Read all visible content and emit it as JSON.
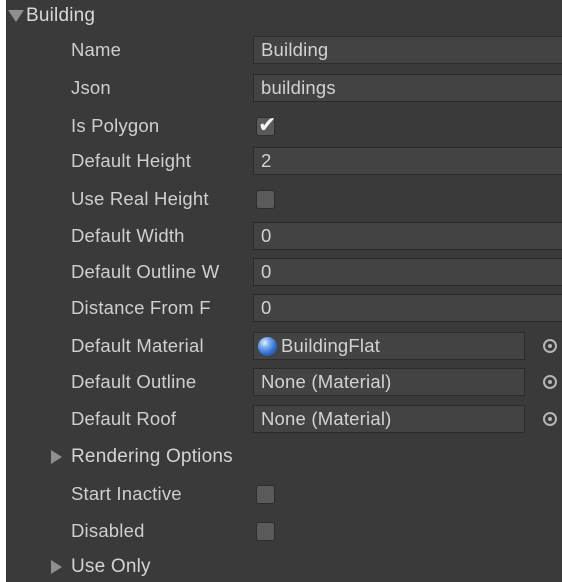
{
  "header": {
    "label": "Building"
  },
  "fields": {
    "name": {
      "label": "Name",
      "value": "Building"
    },
    "json": {
      "label": "Json",
      "value": "buildings"
    },
    "is_polygon": {
      "label": "Is Polygon",
      "checked": true,
      "mark": "✔"
    },
    "default_height": {
      "label": "Default Height",
      "value": "2"
    },
    "use_real_height": {
      "label": "Use Real Height",
      "checked": false
    },
    "default_width": {
      "label": "Default Width",
      "value": "0"
    },
    "default_outline_width": {
      "label": "Default Outline W",
      "value": "0"
    },
    "distance_from_f": {
      "label": "Distance From F",
      "value": "0"
    },
    "default_material": {
      "label": "Default Material",
      "value": "BuildingFlat",
      "icon": "material-sphere-icon"
    },
    "default_outline": {
      "label": "Default Outline",
      "value": "None (Material)"
    },
    "default_roof": {
      "label": "Default Roof",
      "value": "None (Material)"
    }
  },
  "rendering_options": {
    "label": "Rendering Options"
  },
  "start_inactive": {
    "label": "Start Inactive",
    "checked": false
  },
  "disabled": {
    "label": "Disabled",
    "checked": false
  },
  "use_only": {
    "label": "Use Only"
  },
  "colors": {
    "panel_bg": "#3a3a3a",
    "field_bg": "#434343",
    "text": "#cfcfcf"
  }
}
